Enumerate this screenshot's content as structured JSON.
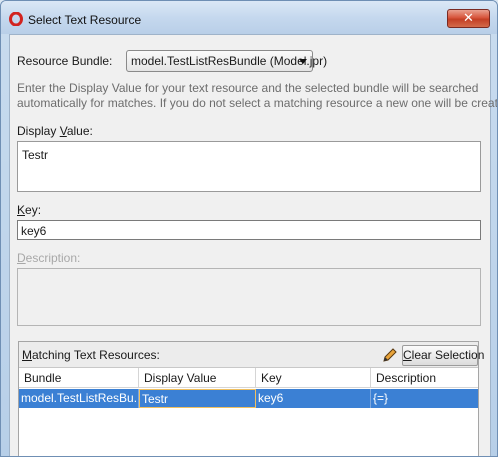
{
  "window": {
    "title": "Select Text Resource",
    "close_glyph": "✕"
  },
  "bundle": {
    "label": "Resource Bundle:",
    "value": "model.TestListResBundle (Model.jpr)"
  },
  "hint": {
    "line1": "Enter the Display Value for your text resource and the selected bundle will be searched",
    "line2": "automatically for matches.  If you do not select a matching resource a new one will be created."
  },
  "display_value": {
    "label_pre": "Display ",
    "label_u": "V",
    "label_post": "alue:",
    "value": "Testr"
  },
  "key": {
    "label_u": "K",
    "label_post": "ey:",
    "value": "key6"
  },
  "description": {
    "label_u": "D",
    "label_post": "escription:",
    "value": ""
  },
  "matches": {
    "label_u": "M",
    "label_post": "atching Text Resources:",
    "clear_u": "C",
    "clear_post": "lear Selection",
    "columns": [
      "Bundle",
      "Display Value",
      "Key",
      "Description"
    ],
    "rows": [
      [
        "model.TestListResBu...",
        "Testr",
        "key6",
        "{=}"
      ]
    ]
  },
  "colors": {
    "selection": "#3b80d4",
    "close_button": "#c33f25"
  },
  "icons": {
    "app": "oracle-ring-icon",
    "edit": "pencil-icon",
    "dropdown": "chevron-down-icon"
  }
}
